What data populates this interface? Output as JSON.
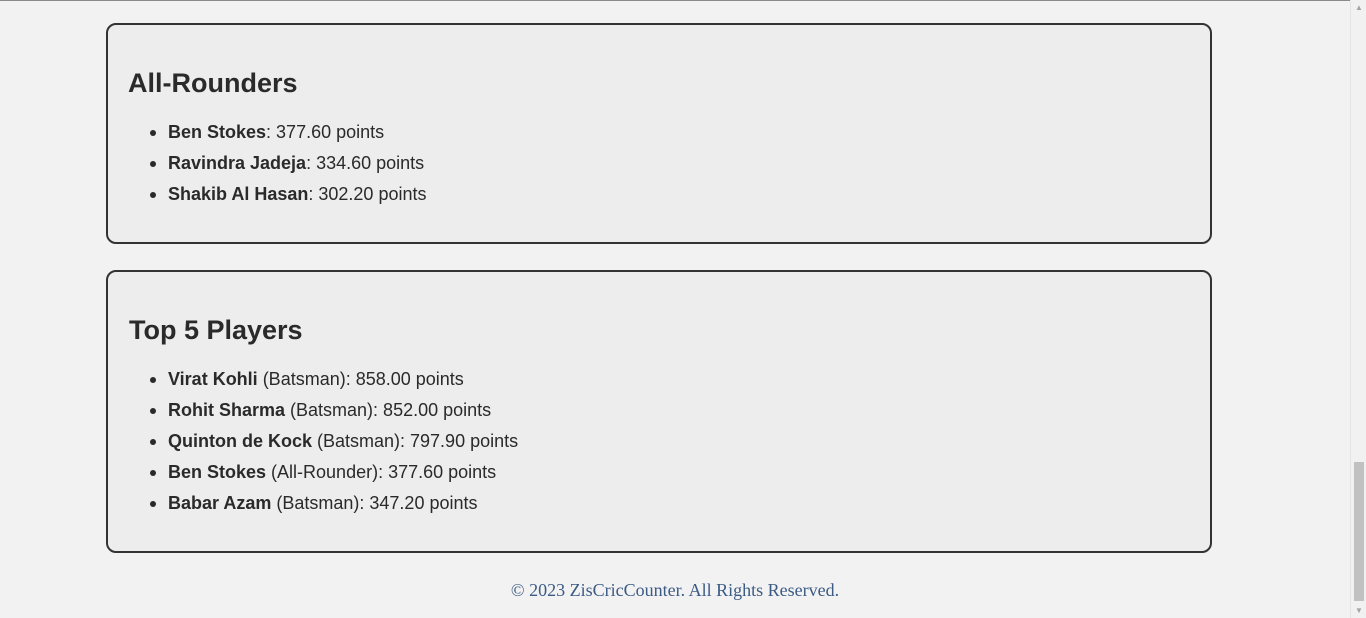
{
  "all_rounders": {
    "title": "All-Rounders",
    "items": [
      {
        "name": "Ben Stokes",
        "text": ": 377.60 points"
      },
      {
        "name": "Ravindra Jadeja",
        "text": ": 334.60 points"
      },
      {
        "name": "Shakib Al Hasan",
        "text": ": 302.20 points"
      }
    ]
  },
  "top_players": {
    "title": "Top 5 Players",
    "items": [
      {
        "name": "Virat Kohli",
        "text": " (Batsman): 858.00 points"
      },
      {
        "name": "Rohit Sharma",
        "text": " (Batsman): 852.00 points"
      },
      {
        "name": "Quinton de Kock",
        "text": " (Batsman): 797.90 points"
      },
      {
        "name": "Ben Stokes",
        "text": " (All-Rounder): 377.60 points"
      },
      {
        "name": "Babar Azam",
        "text": " (Batsman): 347.20 points"
      }
    ]
  },
  "footer": {
    "text": "© 2023 ZisCricCounter. All Rights Reserved."
  },
  "scrollbar": {
    "up_icon": "▲",
    "down_icon": "▼"
  }
}
